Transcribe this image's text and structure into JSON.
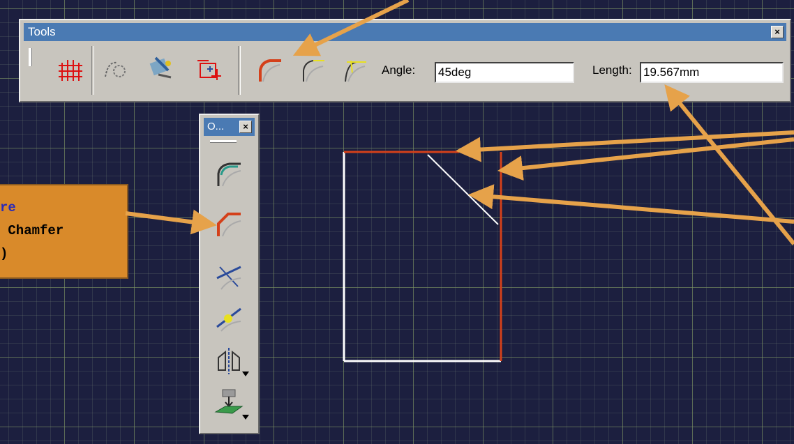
{
  "tools_toolbar": {
    "title": "Tools",
    "close_glyph": "×",
    "angle_label": "Angle:",
    "angle_value": "45deg",
    "length_label": "Length:",
    "length_value": "19.567mm"
  },
  "operations_toolbar": {
    "title": "O...",
    "close_glyph": "×"
  },
  "callout": {
    "lines": [
      "re",
      " Chamfer",
      ")"
    ]
  },
  "colors": {
    "canvas": "#1c1f3f",
    "grid_major": "#7d965f",
    "arrow": "#e6a24a",
    "callout_bg": "#d98a2a",
    "callout_text": "#2a2ab8",
    "sketch_white": "#ffffff",
    "sketch_red": "#d4401a",
    "titlebar": "#4a7ab3"
  },
  "icons": [
    "grid-icon",
    "construction-element-icon",
    "smart-pick-icon",
    "dimension-constraint-icon",
    "trim-all-elements-icon",
    "trim-first-element-icon",
    "no-trim-icon",
    "corner-icon",
    "chamfer-icon",
    "trim-icon",
    "break-icon",
    "symmetry-icon",
    "project-3d-icon"
  ]
}
